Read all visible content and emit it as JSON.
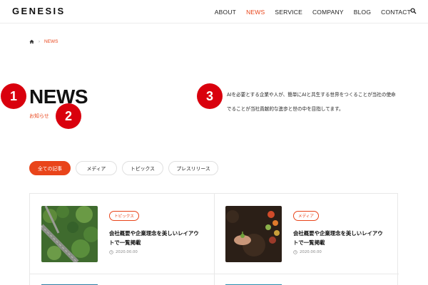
{
  "header": {
    "logo": "GENESIS",
    "nav": [
      "ABOUT",
      "NEWS",
      "SERVICE",
      "COMPANY",
      "BLOG",
      "CONTACT"
    ],
    "active_nav": "NEWS",
    "search_icon": "search-icon"
  },
  "breadcrumb": {
    "home_icon": "home-icon",
    "current": "NEWS"
  },
  "hero": {
    "title": "NEWS",
    "subtitle": "お知らせ",
    "description_line1": "AIを必要とする企業や人が、簡単にAIと共生する世界をつくることが当社の使命",
    "description_line2": "でることが当社貢献的な進歩と世の中を目指してます。"
  },
  "badges": [
    "1",
    "2",
    "3"
  ],
  "filters": [
    "全ての記事",
    "メディア",
    "トピックス",
    "プレスリリース"
  ],
  "articles": [
    {
      "tag": "トピックス",
      "title_line1": "会社概要や企業理念を美しいレイアウ",
      "title_line2": "トで一覧掲載",
      "date": "2020.00.00"
    },
    {
      "tag": "メディア",
      "title_line1": "会社概要や企業理念を美しいレイアウ",
      "title_line2": "トで一覧掲載",
      "date": "2020.00.00"
    }
  ],
  "colors": {
    "accent": "#e9441a",
    "badge": "#d9000d"
  }
}
